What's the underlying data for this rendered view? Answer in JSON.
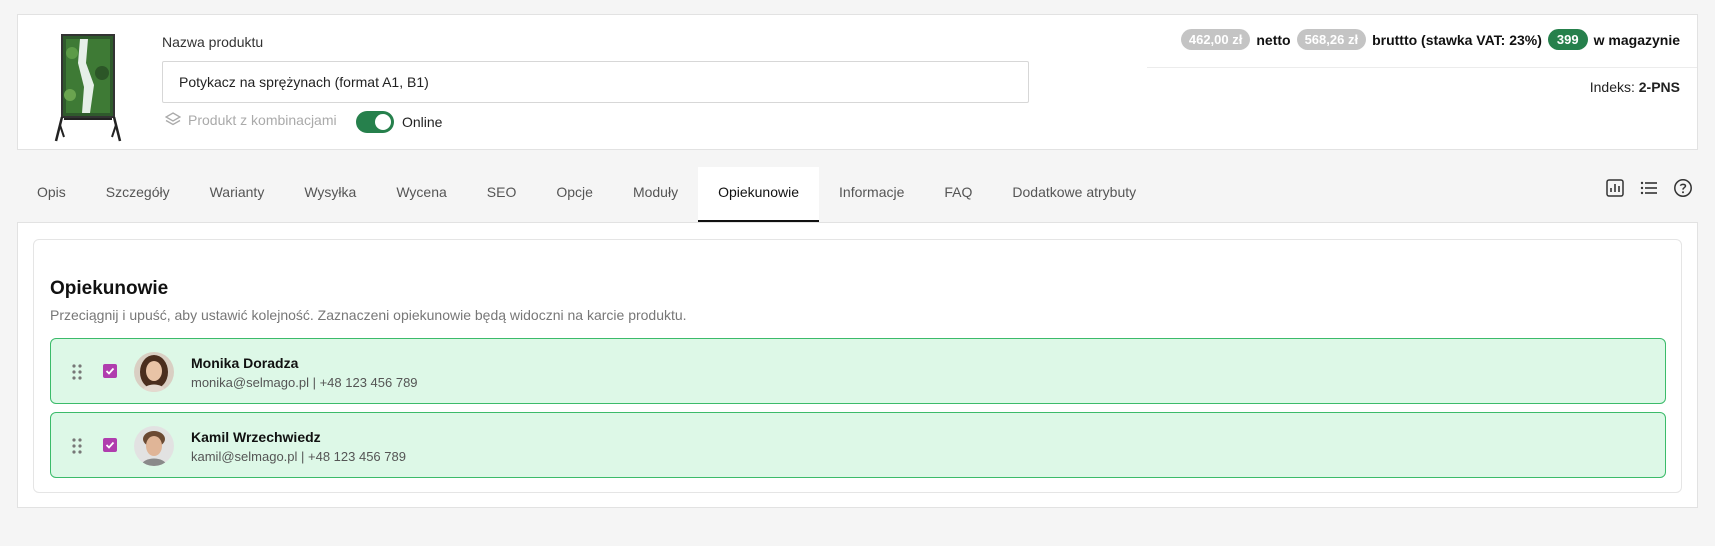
{
  "product": {
    "name_label": "Nazwa produktu",
    "name_value": "Potykacz na sprężynach (format A1, B1)",
    "combinations_label": "Produkt z kombinacjami",
    "online_label": "Online",
    "online": true
  },
  "pricing": {
    "net_price": "462,00 zł",
    "net_label": "netto",
    "gross_price": "568,26 zł",
    "gross_label": "bruttto (stawka VAT: 23%)",
    "stock_count": "399",
    "stock_label": "w magazynie",
    "index_label": "Indeks:",
    "index_value": "2-PNS"
  },
  "tabs": [
    {
      "label": "Opis"
    },
    {
      "label": "Szczegóły"
    },
    {
      "label": "Warianty"
    },
    {
      "label": "Wysyłka"
    },
    {
      "label": "Wycena"
    },
    {
      "label": "SEO"
    },
    {
      "label": "Opcje"
    },
    {
      "label": "Moduły"
    },
    {
      "label": "Opiekunowie"
    },
    {
      "label": "Informacje"
    },
    {
      "label": "FAQ"
    },
    {
      "label": "Dodatkowe atrybuty"
    }
  ],
  "active_tab": "Opiekunowie",
  "toolbar_icons": [
    "chart-icon",
    "list-icon",
    "help-icon"
  ],
  "section": {
    "title": "Opiekunowie",
    "description": "Przeciągnij i upuść, aby ustawić kolejność. Zaznaczeni opiekunowie będą widoczni na karcie produktu.",
    "people": [
      {
        "name": "Monika Doradza",
        "contact": "monika@selmago.pl | +48 123 456 789",
        "checked": true
      },
      {
        "name": "Kamil Wrzechwiedz",
        "contact": "kamil@selmago.pl | +48 123 456 789",
        "checked": true
      }
    ]
  },
  "colors": {
    "accent_green": "#26804c",
    "row_bg": "#ddf8e7",
    "row_border": "#3bbb6a",
    "checkbox": "#b03dae",
    "pill_gray": "#c4c4c4"
  }
}
